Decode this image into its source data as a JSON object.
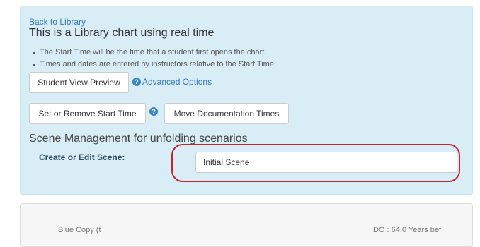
{
  "header": {
    "back_link": "Back to Library",
    "title": "This is a Library chart using real time"
  },
  "notes": [
    "The Start Time will be the time that a student first opens the chart.",
    "Times and dates are entered by instructors relative to the Start Time."
  ],
  "actions": {
    "student_view_preview": "Student View Preview",
    "advanced_options": "Advanced Options",
    "set_remove_start_time": "Set or Remove Start Time",
    "move_documentation_times": "Move Documentation Times",
    "help_glyph": "?"
  },
  "scene_management": {
    "heading": "Scene Management for unfolding scenarios",
    "label": "Create or Edit Scene:",
    "value": "Initial Scene"
  },
  "lower_panel": {
    "left_text": "Blue Copy (t",
    "right_text": "DO : 64.0 Years bef"
  },
  "colors": {
    "panel_bg": "#d9edf7",
    "link": "#337ab7",
    "highlight": "#c0262c"
  }
}
